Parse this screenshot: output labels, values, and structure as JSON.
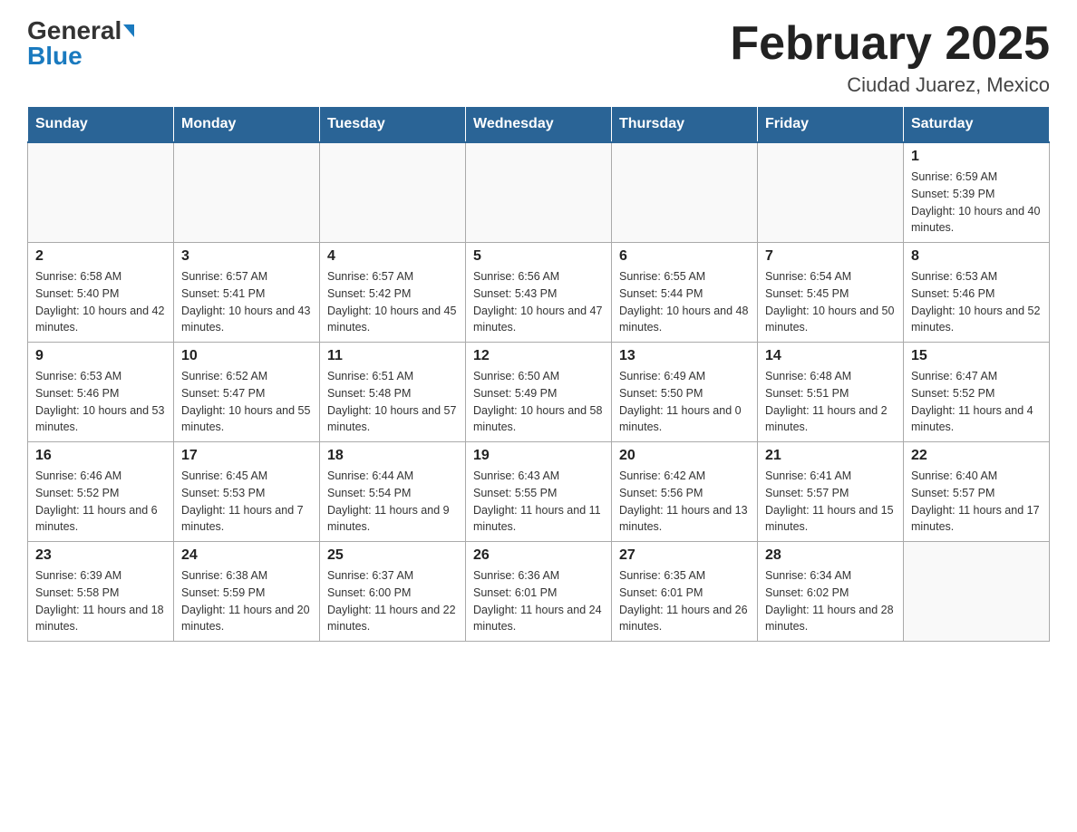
{
  "header": {
    "logo_general": "General",
    "logo_blue": "Blue",
    "month_title": "February 2025",
    "location": "Ciudad Juarez, Mexico"
  },
  "weekdays": [
    "Sunday",
    "Monday",
    "Tuesday",
    "Wednesday",
    "Thursday",
    "Friday",
    "Saturday"
  ],
  "weeks": [
    [
      {
        "day": "",
        "sunrise": "",
        "sunset": "",
        "daylight": ""
      },
      {
        "day": "",
        "sunrise": "",
        "sunset": "",
        "daylight": ""
      },
      {
        "day": "",
        "sunrise": "",
        "sunset": "",
        "daylight": ""
      },
      {
        "day": "",
        "sunrise": "",
        "sunset": "",
        "daylight": ""
      },
      {
        "day": "",
        "sunrise": "",
        "sunset": "",
        "daylight": ""
      },
      {
        "day": "",
        "sunrise": "",
        "sunset": "",
        "daylight": ""
      },
      {
        "day": "1",
        "sunrise": "Sunrise: 6:59 AM",
        "sunset": "Sunset: 5:39 PM",
        "daylight": "Daylight: 10 hours and 40 minutes."
      }
    ],
    [
      {
        "day": "2",
        "sunrise": "Sunrise: 6:58 AM",
        "sunset": "Sunset: 5:40 PM",
        "daylight": "Daylight: 10 hours and 42 minutes."
      },
      {
        "day": "3",
        "sunrise": "Sunrise: 6:57 AM",
        "sunset": "Sunset: 5:41 PM",
        "daylight": "Daylight: 10 hours and 43 minutes."
      },
      {
        "day": "4",
        "sunrise": "Sunrise: 6:57 AM",
        "sunset": "Sunset: 5:42 PM",
        "daylight": "Daylight: 10 hours and 45 minutes."
      },
      {
        "day": "5",
        "sunrise": "Sunrise: 6:56 AM",
        "sunset": "Sunset: 5:43 PM",
        "daylight": "Daylight: 10 hours and 47 minutes."
      },
      {
        "day": "6",
        "sunrise": "Sunrise: 6:55 AM",
        "sunset": "Sunset: 5:44 PM",
        "daylight": "Daylight: 10 hours and 48 minutes."
      },
      {
        "day": "7",
        "sunrise": "Sunrise: 6:54 AM",
        "sunset": "Sunset: 5:45 PM",
        "daylight": "Daylight: 10 hours and 50 minutes."
      },
      {
        "day": "8",
        "sunrise": "Sunrise: 6:53 AM",
        "sunset": "Sunset: 5:46 PM",
        "daylight": "Daylight: 10 hours and 52 minutes."
      }
    ],
    [
      {
        "day": "9",
        "sunrise": "Sunrise: 6:53 AM",
        "sunset": "Sunset: 5:46 PM",
        "daylight": "Daylight: 10 hours and 53 minutes."
      },
      {
        "day": "10",
        "sunrise": "Sunrise: 6:52 AM",
        "sunset": "Sunset: 5:47 PM",
        "daylight": "Daylight: 10 hours and 55 minutes."
      },
      {
        "day": "11",
        "sunrise": "Sunrise: 6:51 AM",
        "sunset": "Sunset: 5:48 PM",
        "daylight": "Daylight: 10 hours and 57 minutes."
      },
      {
        "day": "12",
        "sunrise": "Sunrise: 6:50 AM",
        "sunset": "Sunset: 5:49 PM",
        "daylight": "Daylight: 10 hours and 58 minutes."
      },
      {
        "day": "13",
        "sunrise": "Sunrise: 6:49 AM",
        "sunset": "Sunset: 5:50 PM",
        "daylight": "Daylight: 11 hours and 0 minutes."
      },
      {
        "day": "14",
        "sunrise": "Sunrise: 6:48 AM",
        "sunset": "Sunset: 5:51 PM",
        "daylight": "Daylight: 11 hours and 2 minutes."
      },
      {
        "day": "15",
        "sunrise": "Sunrise: 6:47 AM",
        "sunset": "Sunset: 5:52 PM",
        "daylight": "Daylight: 11 hours and 4 minutes."
      }
    ],
    [
      {
        "day": "16",
        "sunrise": "Sunrise: 6:46 AM",
        "sunset": "Sunset: 5:52 PM",
        "daylight": "Daylight: 11 hours and 6 minutes."
      },
      {
        "day": "17",
        "sunrise": "Sunrise: 6:45 AM",
        "sunset": "Sunset: 5:53 PM",
        "daylight": "Daylight: 11 hours and 7 minutes."
      },
      {
        "day": "18",
        "sunrise": "Sunrise: 6:44 AM",
        "sunset": "Sunset: 5:54 PM",
        "daylight": "Daylight: 11 hours and 9 minutes."
      },
      {
        "day": "19",
        "sunrise": "Sunrise: 6:43 AM",
        "sunset": "Sunset: 5:55 PM",
        "daylight": "Daylight: 11 hours and 11 minutes."
      },
      {
        "day": "20",
        "sunrise": "Sunrise: 6:42 AM",
        "sunset": "Sunset: 5:56 PM",
        "daylight": "Daylight: 11 hours and 13 minutes."
      },
      {
        "day": "21",
        "sunrise": "Sunrise: 6:41 AM",
        "sunset": "Sunset: 5:57 PM",
        "daylight": "Daylight: 11 hours and 15 minutes."
      },
      {
        "day": "22",
        "sunrise": "Sunrise: 6:40 AM",
        "sunset": "Sunset: 5:57 PM",
        "daylight": "Daylight: 11 hours and 17 minutes."
      }
    ],
    [
      {
        "day": "23",
        "sunrise": "Sunrise: 6:39 AM",
        "sunset": "Sunset: 5:58 PM",
        "daylight": "Daylight: 11 hours and 18 minutes."
      },
      {
        "day": "24",
        "sunrise": "Sunrise: 6:38 AM",
        "sunset": "Sunset: 5:59 PM",
        "daylight": "Daylight: 11 hours and 20 minutes."
      },
      {
        "day": "25",
        "sunrise": "Sunrise: 6:37 AM",
        "sunset": "Sunset: 6:00 PM",
        "daylight": "Daylight: 11 hours and 22 minutes."
      },
      {
        "day": "26",
        "sunrise": "Sunrise: 6:36 AM",
        "sunset": "Sunset: 6:01 PM",
        "daylight": "Daylight: 11 hours and 24 minutes."
      },
      {
        "day": "27",
        "sunrise": "Sunrise: 6:35 AM",
        "sunset": "Sunset: 6:01 PM",
        "daylight": "Daylight: 11 hours and 26 minutes."
      },
      {
        "day": "28",
        "sunrise": "Sunrise: 6:34 AM",
        "sunset": "Sunset: 6:02 PM",
        "daylight": "Daylight: 11 hours and 28 minutes."
      },
      {
        "day": "",
        "sunrise": "",
        "sunset": "",
        "daylight": ""
      }
    ]
  ]
}
